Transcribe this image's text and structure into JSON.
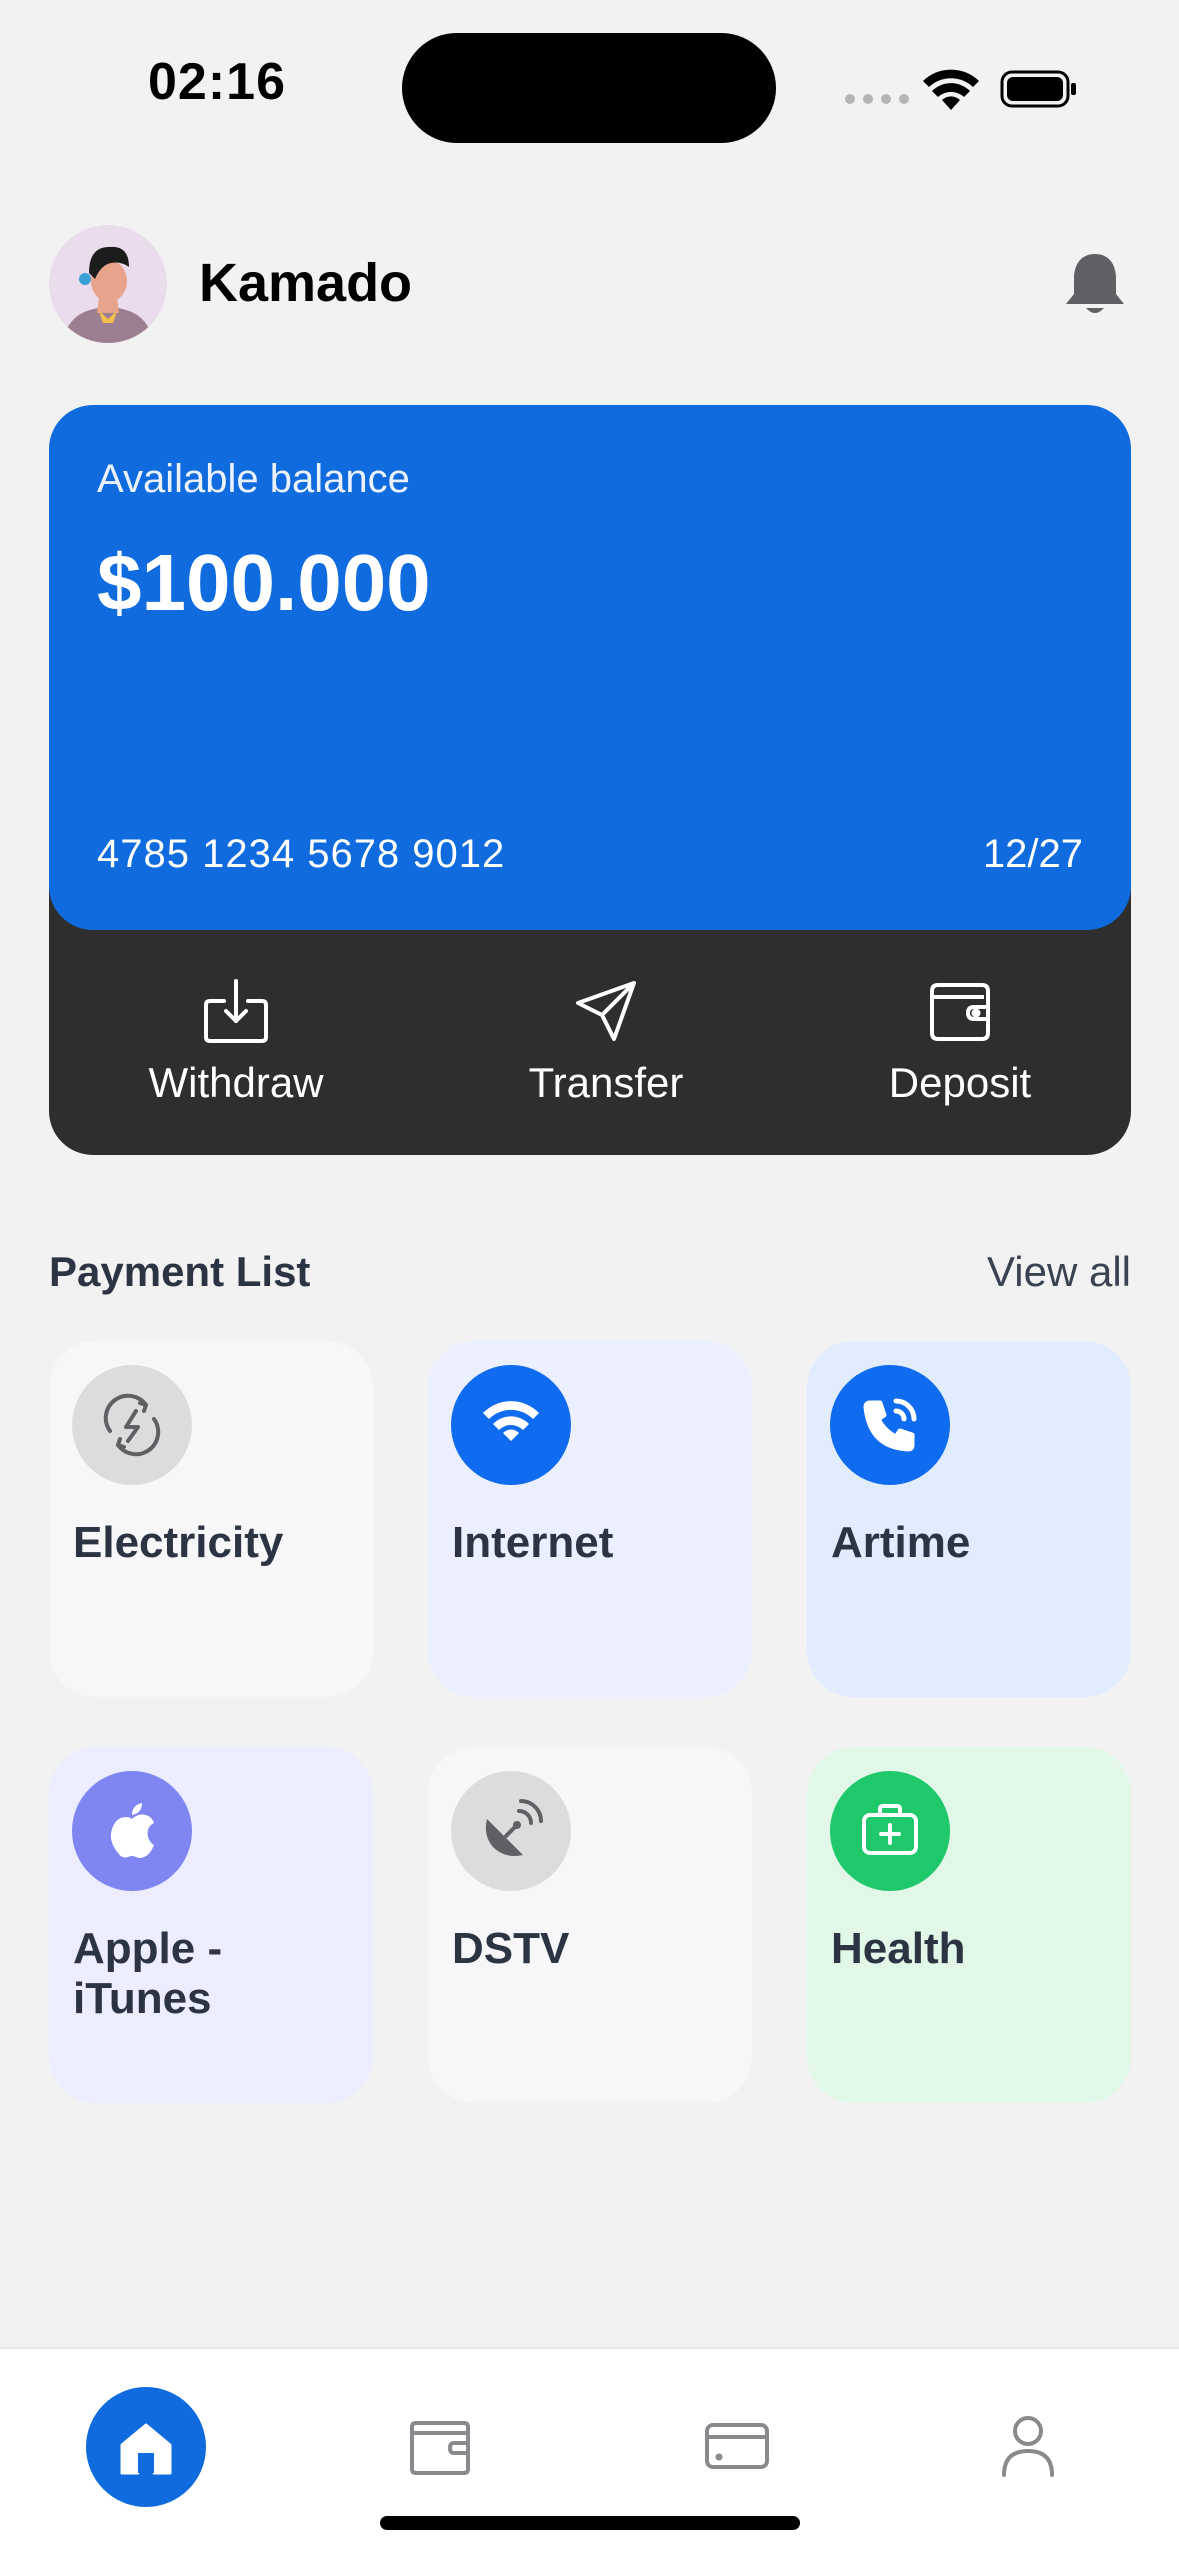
{
  "status_bar": {
    "time": "02:16"
  },
  "header": {
    "username": "Kamado"
  },
  "card": {
    "label": "Available balance",
    "balance": "$100.000",
    "number": "4785 1234 5678 9012",
    "expiry": "12/27",
    "colors": {
      "card": "#0f6bde",
      "actions_bg": "#2e2e2e"
    }
  },
  "actions": [
    {
      "label": "Withdraw",
      "icon": "withdraw-icon"
    },
    {
      "label": "Transfer",
      "icon": "send-icon"
    },
    {
      "label": "Deposit",
      "icon": "wallet-icon"
    }
  ],
  "payment_list": {
    "title": "Payment List",
    "view_all": "View all",
    "items": [
      {
        "label": "Electricity",
        "icon": "electricity-icon"
      },
      {
        "label": "Internet",
        "icon": "wifi-icon"
      },
      {
        "label": "Artime",
        "icon": "phone-call-icon"
      },
      {
        "label": "Apple - iTunes",
        "icon": "apple-icon"
      },
      {
        "label": "DSTV",
        "icon": "satellite-dish-icon"
      },
      {
        "label": "Health",
        "icon": "medical-kit-icon"
      }
    ]
  },
  "bottom_nav": [
    {
      "icon": "home-icon",
      "active": true
    },
    {
      "icon": "wallet-icon",
      "active": false
    },
    {
      "icon": "credit-card-icon",
      "active": false
    },
    {
      "icon": "user-icon",
      "active": false
    }
  ]
}
